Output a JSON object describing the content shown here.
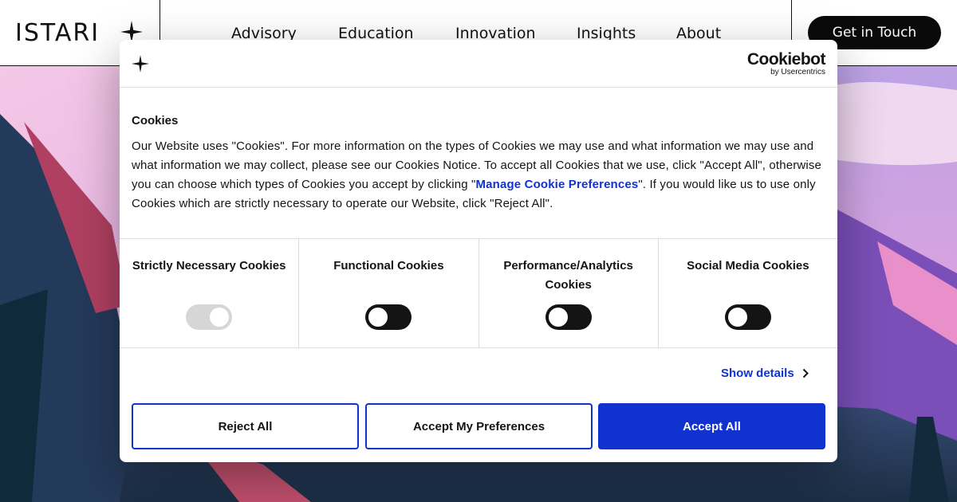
{
  "site": {
    "logo_text": "ISTARI",
    "nav": [
      "Advisory",
      "Education",
      "Innovation",
      "Insights",
      "About"
    ],
    "cta_label": "Get in Touch"
  },
  "cookie_dialog": {
    "brand_name": "Cookiebot",
    "brand_by": "by Usercentrics",
    "title": "Cookies",
    "text_before_link": "Our Website uses \"Cookies\". For more information on the types of Cookies we may use and what information we may use and what information we may collect, please see our Cookies Notice. To accept all Cookies that we use, click \"Accept All\", otherwise you can choose which types of Cookies you accept by clicking \"",
    "link_text": "Manage Cookie Preferences",
    "text_after_link": "\". If you would like us to use only Cookies which are strictly necessary to operate our Website, click \"Reject All\".",
    "categories": [
      {
        "label": "Strictly Necessary Cookies",
        "enabled": true,
        "locked": true
      },
      {
        "label": "Functional Cookies",
        "enabled": false,
        "locked": false
      },
      {
        "label": "Performance/Analytics Cookies",
        "enabled": false,
        "locked": false
      },
      {
        "label": "Social Media Cookies",
        "enabled": false,
        "locked": false
      }
    ],
    "show_details_label": "Show details",
    "buttons": {
      "reject": "Reject All",
      "preferences": "Accept My Preferences",
      "accept": "Accept All"
    }
  },
  "colors": {
    "accent": "#1032cf",
    "toggle_off": "#141414",
    "toggle_locked": "#d6d6d6",
    "nav_cta_bg": "#0a0a0a"
  }
}
